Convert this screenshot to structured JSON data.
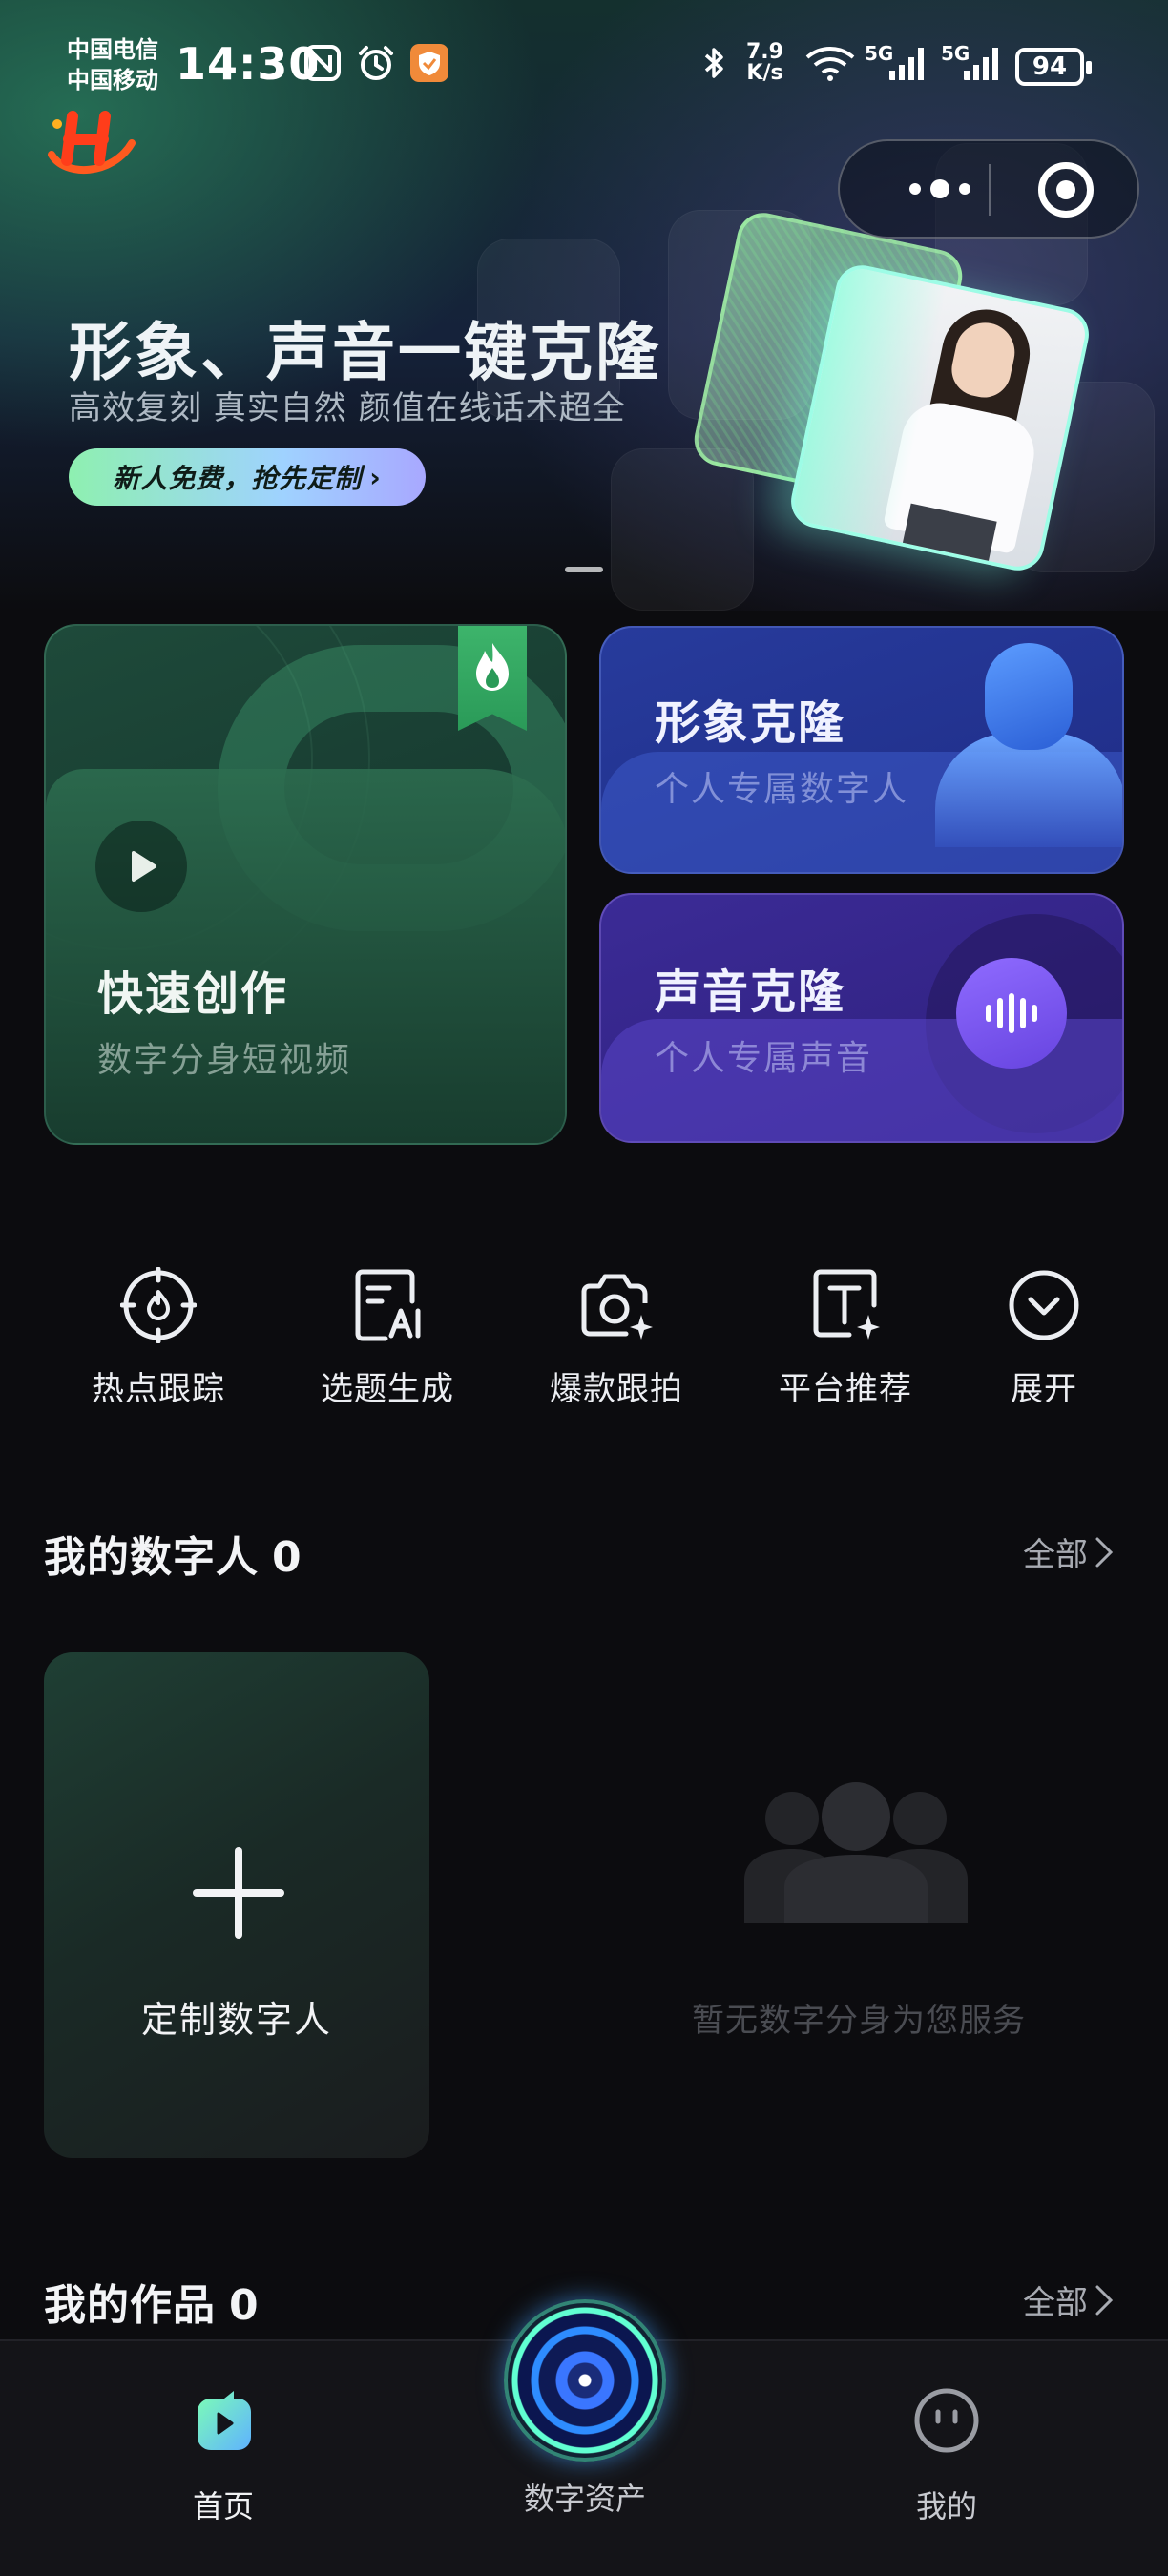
{
  "status_bar": {
    "carrier_1": "中国电信",
    "carrier_2": "中国移动",
    "time": "14:30",
    "net_speed_value": "7.9",
    "net_speed_unit": "K/s",
    "signal_1": "5G",
    "signal_2": "5G",
    "battery": "94",
    "icons": [
      "nfc-icon",
      "alarm-icon",
      "app-shield-icon",
      "bluetooth-icon",
      "wifi-icon",
      "signal-icon"
    ]
  },
  "hero": {
    "title": "形象、声音一键克隆",
    "subtitle": "高效复刻 真实自然 颜值在线话术超全",
    "promo": "新人免费，抢先定制",
    "promo_chevron": "›"
  },
  "features": {
    "quick_create": {
      "title": "快速创作",
      "subtitle": "数字分身短视频"
    },
    "image_clone": {
      "title": "形象克隆",
      "subtitle": "个人专属数字人"
    },
    "voice_clone": {
      "title": "声音克隆",
      "subtitle": "个人专属声音"
    }
  },
  "tools": [
    {
      "label": "热点跟踪",
      "icon": "target-icon"
    },
    {
      "label": "选题生成",
      "icon": "topic-ai-icon"
    },
    {
      "label": "爆款跟拍",
      "icon": "camera-spark-icon"
    },
    {
      "label": "平台推荐",
      "icon": "text-spark-icon"
    },
    {
      "label": "展开",
      "icon": "chevron-down-circle-icon"
    }
  ],
  "digital_people": {
    "title": "我的数字人",
    "count": "0",
    "more": "全部",
    "custom_label": "定制数字人",
    "empty_text": "暂无数字分身为您服务"
  },
  "works": {
    "title": "我的作品",
    "count": "0",
    "more": "全部"
  },
  "tabbar": {
    "home": "首页",
    "assets": "数字资产",
    "mine": "我的"
  },
  "colors": {
    "background": "#0c0c0f",
    "quick_card": "#1e4a3a",
    "image_card": "#273b9c",
    "voice_card": "#3b2b96",
    "promo_start": "#8ef0b0",
    "promo_end": "#a8a8ff"
  }
}
